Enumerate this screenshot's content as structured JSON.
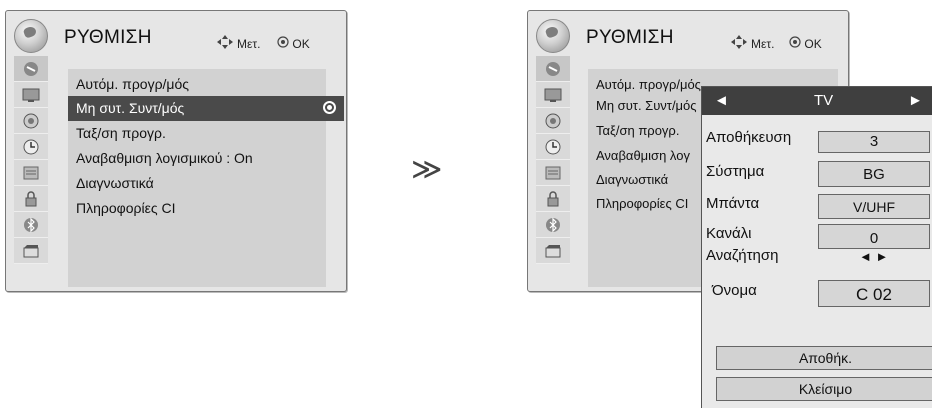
{
  "left_panel": {
    "title": "ΡΥΘΜΙΣΗ",
    "hint_move": "Μετ.",
    "hint_ok": "OK",
    "items": [
      {
        "label": "Αυτόμ. προγρ/μός"
      },
      {
        "label": "Μη συτ. Συντ/μός"
      },
      {
        "label": "Ταξ/ση προγρ."
      },
      {
        "label": "Αναβαθμιση λογισμικού   : On"
      },
      {
        "label": "Διαγνωστικά"
      },
      {
        "label": "Πληροφορίες CI"
      }
    ],
    "selected_index": 1
  },
  "separator_symbol": "≫",
  "right_panel": {
    "title": "ΡΥΘΜΙΣΗ",
    "hint_move": "Μετ.",
    "hint_ok": "OK",
    "items": [
      {
        "label": "Αυτόμ. προγρ/μός"
      },
      {
        "label": "Μη συτ. Συντ/μός"
      },
      {
        "label": "Ταξ/ση προγρ."
      },
      {
        "label": "Αναβαθμιση λογ"
      },
      {
        "label": "Διαγνωστικά"
      },
      {
        "label": "Πληροφορίες CI"
      }
    ]
  },
  "popup": {
    "prev_arrow": "◄",
    "source": "TV",
    "next_arrow": "►",
    "rows": [
      {
        "label": "Αποθήκευση",
        "value": "3"
      },
      {
        "label": "Σύστημα",
        "value": "BG"
      },
      {
        "label": "Μπάντα",
        "value": "V/UHF"
      },
      {
        "label": "Κανάλι",
        "value": "0"
      },
      {
        "label": "Αναζήτηση",
        "value": "◄ ►"
      },
      {
        "label": "Όνομα",
        "value": "C  02"
      }
    ],
    "store_button": "Αποθήκ.",
    "close_button": "Κλείσιμο"
  },
  "icons": [
    "antenna-icon",
    "picture-icon",
    "audio-icon",
    "time-icon",
    "lock-list-icon",
    "security-icon",
    "bluetooth-icon",
    "media-icon"
  ]
}
